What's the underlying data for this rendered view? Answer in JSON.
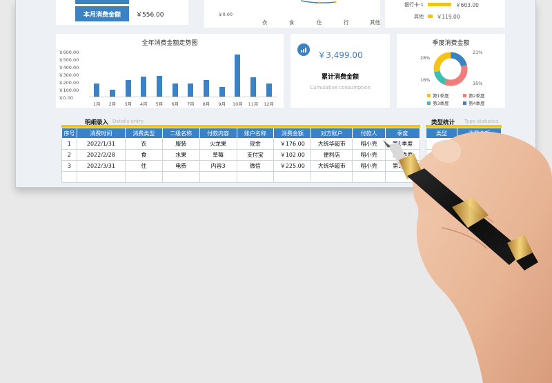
{
  "monthly_card": {
    "label": "本月消费金额",
    "value": "￥556.00"
  },
  "category_chart": {
    "ytick": "￥0.00",
    "categories": [
      "衣",
      "食",
      "住",
      "行",
      "其他"
    ]
  },
  "account_chart": {
    "rows": [
      {
        "name": "银行卡-1",
        "value": "￥603.00",
        "fraction": 0.95
      },
      {
        "name": "其他",
        "value": "￥119.00",
        "fraction": 0.19
      }
    ]
  },
  "trend_chart": {
    "title": "全年消费金额走势图",
    "yticks": [
      "￥600.00",
      "￥500.00",
      "￥400.00",
      "￥300.00",
      "￥200.00",
      "￥100.00",
      "￥0.00"
    ],
    "ylim": [
      0,
      600
    ]
  },
  "chart_data": {
    "type": "bar",
    "title": "全年消费金额走势图",
    "categories": [
      "1月",
      "2月",
      "3月",
      "4月",
      "5月",
      "6月",
      "7月",
      "8月",
      "9月",
      "10月",
      "11月",
      "12月"
    ],
    "values": [
      170,
      95,
      220,
      260,
      275,
      170,
      175,
      215,
      130,
      555,
      255,
      170
    ],
    "ylim": [
      0,
      600
    ],
    "grid": false
  },
  "total_card": {
    "value": "￥3,499.00",
    "title": "累计消费金额",
    "subtitle": "Cumulative consumption"
  },
  "quarter_chart": {
    "title": "季度消费金额",
    "slices": [
      {
        "name": "第1季度",
        "percent": 28,
        "color": "#f5c216"
      },
      {
        "name": "第2季度",
        "percent": 35,
        "color": "#f07c7c"
      },
      {
        "name": "第3季度",
        "percent": 16,
        "color": "#3bbfb0"
      },
      {
        "name": "第4季度",
        "percent": 21,
        "color": "#3b82c4"
      }
    ],
    "labels": [
      "28%",
      "21%",
      "35%",
      "16%"
    ]
  },
  "details": {
    "title": "明细录入",
    "subtitle": "Details entry",
    "headers": [
      "序号",
      "消费时间",
      "消费类型",
      "二级名称",
      "付款内容",
      "账户名称",
      "消费金额",
      "对方账户",
      "付款人",
      "季度"
    ],
    "rows": [
      [
        "1",
        "2022/1/31",
        "衣",
        "服装",
        "火龙果",
        "现金",
        "￥176.00",
        "大统华超市",
        "稻小壳",
        "第1季度"
      ],
      [
        "2",
        "2022/2/28",
        "食",
        "水果",
        "草莓",
        "支付宝",
        "￥102.00",
        "便利店",
        "稻小壳",
        "第1季度"
      ],
      [
        "3",
        "2022/3/31",
        "住",
        "电费",
        "内容3",
        "微信",
        "￥225.00",
        "大统华超市",
        "稻小壳",
        "第1季度"
      ]
    ]
  },
  "type_stats": {
    "title": "类型统计",
    "subtitle": "Type statistics",
    "headers": [
      "类型",
      "消费金额"
    ]
  },
  "colors": {
    "accent": "#3b82c4",
    "yellow": "#f5c216",
    "teal": "#3bbfb0",
    "red": "#f07c7c"
  }
}
